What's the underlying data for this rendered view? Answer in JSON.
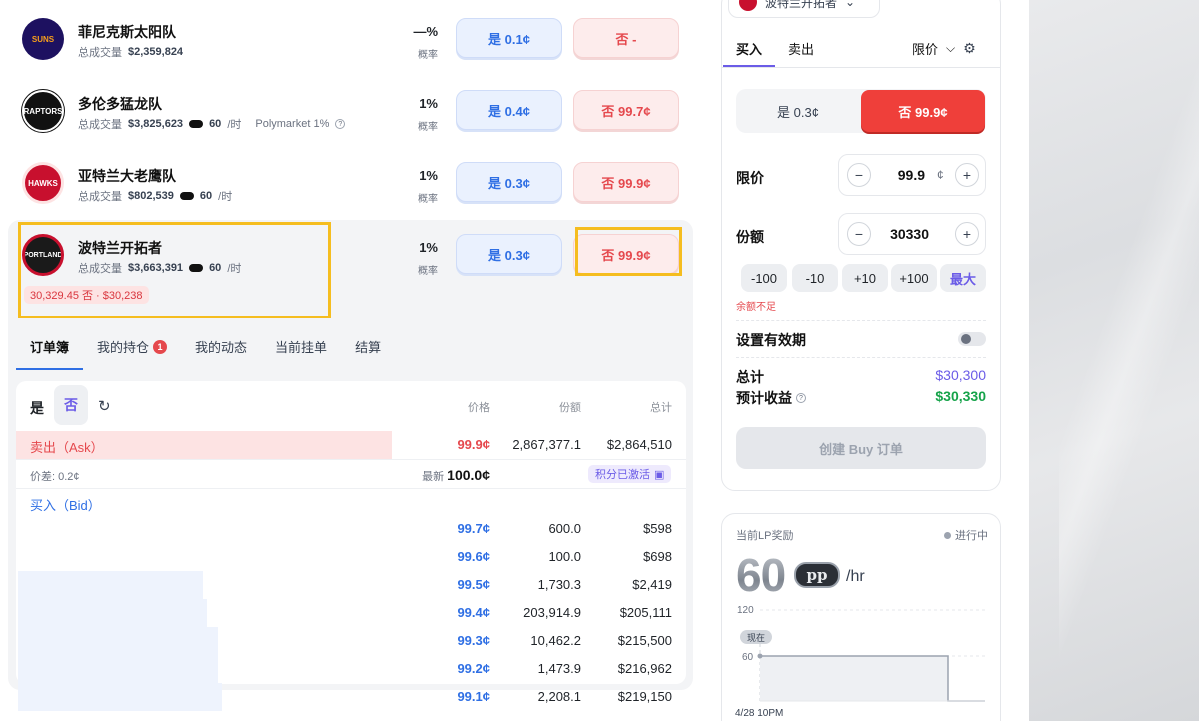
{
  "markets": [
    {
      "name": "菲尼克斯太阳队",
      "volume_label": "总成交量",
      "volume": "$2,359,824",
      "reward": "",
      "reward_unit": "",
      "source": "",
      "prob": "—%",
      "prob_label": "概率",
      "yes": "是 0.1¢",
      "no": "否 -",
      "logo_text": "SUNS",
      "logo_color": "#1d1160"
    },
    {
      "name": "多伦多猛龙队",
      "volume_label": "总成交量",
      "volume": "$3,825,623",
      "reward": "60",
      "reward_unit": "/时",
      "source": "Polymarket 1%",
      "prob": "1%",
      "prob_label": "概率",
      "yes": "是 0.4¢",
      "no": "否 99.7¢",
      "logo_text": "RAPTORS",
      "logo_color": "#111111"
    },
    {
      "name": "亚特兰大老鹰队",
      "volume_label": "总成交量",
      "volume": "$802,539",
      "reward": "60",
      "reward_unit": "/时",
      "source": "",
      "prob": "1%",
      "prob_label": "概率",
      "yes": "是 0.3¢",
      "no": "否 99.9¢",
      "logo_text": "HAWKS",
      "logo_color": "#c8102e"
    },
    {
      "name": "波特兰开拓者",
      "volume_label": "总成交量",
      "volume": "$3,663,391",
      "reward": "60",
      "reward_unit": "/时",
      "source": "",
      "prob": "1%",
      "prob_label": "概率",
      "yes": "是 0.3¢",
      "no": "否 99.9¢",
      "logo_text": "PORTLAND",
      "logo_color": "#c8102e"
    }
  ],
  "position_tag": "30,329.45 否 · $30,238",
  "tabs": [
    {
      "label": "订单簿"
    },
    {
      "label": "我的持仓",
      "badge": "1"
    },
    {
      "label": "我的动态"
    },
    {
      "label": "当前挂单"
    },
    {
      "label": "结算"
    }
  ],
  "orderbook": {
    "yes_label": "是",
    "no_label": "否",
    "col_price": "价格",
    "col_shares": "份额",
    "col_total": "总计",
    "ask_label": "卖出（Ask）",
    "ask": {
      "price": "99.9¢",
      "shares": "2,867,377.1",
      "total": "$2,864,510"
    },
    "spread_label": "价差: 0.2¢",
    "last_label": "最新",
    "last_value": "100.0¢",
    "points_badge": "积分已激活",
    "bid_label": "买入（Bid）",
    "bids": [
      {
        "price": "99.7¢",
        "shares": "600.0",
        "total": "$598",
        "depth": 0.0
      },
      {
        "price": "99.6¢",
        "shares": "100.0",
        "total": "$698",
        "depth": 0.0
      },
      {
        "price": "99.5¢",
        "shares": "1,730.3",
        "total": "$2,419",
        "depth": 0.5
      },
      {
        "price": "99.4¢",
        "shares": "203,914.9",
        "total": "$205,111",
        "depth": 0.51
      },
      {
        "price": "99.3¢",
        "shares": "10,462.2",
        "total": "$215,500",
        "depth": 0.54
      },
      {
        "price": "99.2¢",
        "shares": "1,473.9",
        "total": "$216,962",
        "depth": 0.54
      },
      {
        "price": "99.1¢",
        "shares": "2,208.1",
        "total": "$219,150",
        "depth": 0.55
      }
    ]
  },
  "trade": {
    "market_select": "波特兰开拓者",
    "buy_tab": "买入",
    "sell_tab": "卖出",
    "order_type": "限价",
    "yes_option": "是  0.3¢",
    "no_option": "否  99.9¢",
    "limit_label": "限价",
    "limit_value": "99.9",
    "limit_unit": "¢",
    "shares_label": "份额",
    "shares_value": "30330",
    "quick": [
      "-100",
      "-10",
      "+10",
      "+100",
      "最大"
    ],
    "warning": "余额不足",
    "expiry_label": "设置有效期",
    "total_label": "总计",
    "total_value": "$30,300",
    "profit_label": "预计收益",
    "profit_value": "$30,330",
    "submit": "创建 Buy 订单"
  },
  "lp": {
    "title": "当前LP奖励",
    "status": "进行中",
    "amount": "60",
    "token": "pp",
    "unit": "/hr",
    "now_label": "现在",
    "y_ticks": [
      "120",
      "60"
    ],
    "x_label": "4/28 10PM"
  },
  "colors": {
    "accent": "#6b5ce7",
    "yes": "#2f6fe4",
    "no": "#e5484d",
    "profit": "#16a34a"
  }
}
